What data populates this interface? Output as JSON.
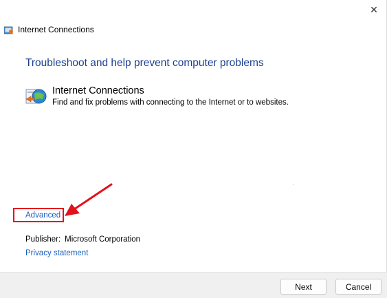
{
  "window": {
    "title": "Internet Connections",
    "close_glyph": "✕"
  },
  "main": {
    "heading": "Troubleshoot and help prevent computer problems",
    "item": {
      "icon": "internet-connections-icon",
      "title": "Internet Connections",
      "description": "Find and fix problems with connecting to the Internet or to websites."
    },
    "advanced_label": "Advanced",
    "publisher_label": "Publisher:",
    "publisher_value": "Microsoft Corporation",
    "privacy_label": "Privacy statement"
  },
  "footer": {
    "next_label": "Next",
    "cancel_label": "Cancel"
  },
  "colors": {
    "heading": "#1a3f8f",
    "link": "#1a5fbf",
    "highlight": "#e3111b"
  }
}
